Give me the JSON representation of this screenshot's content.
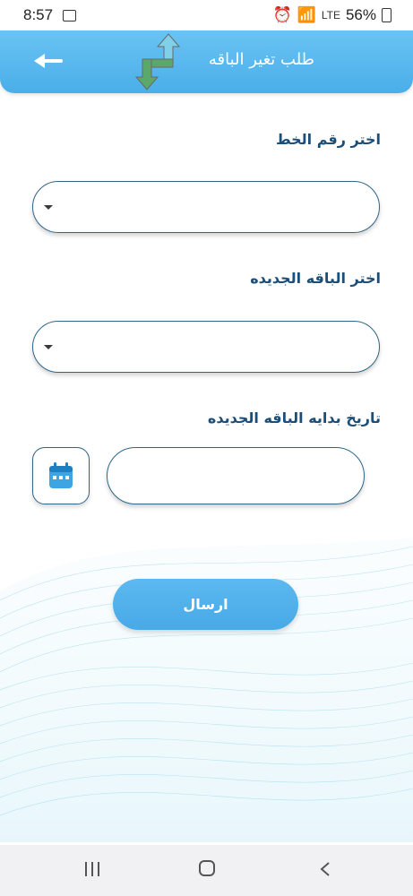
{
  "status_bar": {
    "time": "8:57",
    "network_label": "LTE",
    "battery": "56%"
  },
  "header": {
    "title": "طلب تغير الباقه",
    "back_icon": "arrow-left-icon",
    "logo_icon": "swap-arrows-icon"
  },
  "form": {
    "line_label": "اختر رقم الخط",
    "line_value": "",
    "package_label": "اختر الباقه الجديده",
    "package_value": "",
    "date_label": "تاريخ بدايه الباقه الجديده",
    "date_value": "",
    "calendar_icon": "calendar-icon"
  },
  "submit_label": "ارسال",
  "colors": {
    "header": "#4aaee9",
    "label_text": "#1b4e78",
    "border": "#2f6688",
    "button": "#4eb0ea"
  }
}
